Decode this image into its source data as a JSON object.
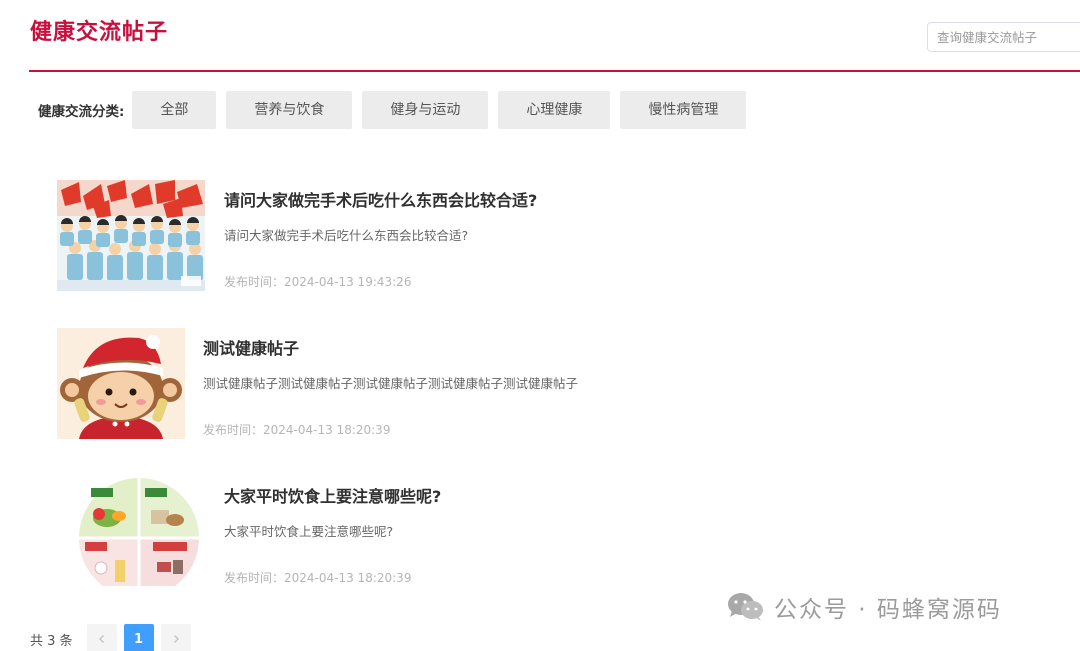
{
  "header": {
    "title": "健康交流帖子",
    "search_placeholder": "查询健康交流帖子",
    "accent_color": "#c8103e"
  },
  "categories": {
    "label": "健康交流分类:",
    "items": [
      "全部",
      "营养与饮食",
      "健身与运动",
      "心理健康",
      "慢性病管理"
    ]
  },
  "posts": [
    {
      "title": "请问大家做完手术后吃什么东西会比较合适?",
      "summary": "请问大家做完手术后吃什么东西会比较合适?",
      "time": "发布时间：2024-04-13 19:43:26",
      "image": "crowd-photo"
    },
    {
      "title": "测试健康帖子",
      "summary": "测试健康帖子测试健康帖子测试健康帖子测试健康帖子测试健康帖子",
      "time": "发布时间：2024-04-13 18:20:39",
      "image": "monkey-illustration"
    },
    {
      "title": "大家平时饮食上要注意哪些呢?",
      "summary": "大家平时饮食上要注意哪些呢?",
      "time": "发布时间：2024-04-13 18:20:39",
      "image": "food-pyramid-chart"
    }
  ],
  "pagination": {
    "total": "共 3 条",
    "pages": [
      "1"
    ],
    "current": "1",
    "prev_icon": "chevron-left-icon",
    "next_icon": "chevron-right-icon"
  },
  "watermark": {
    "text": "公众号 · 码蜂窝源码"
  }
}
